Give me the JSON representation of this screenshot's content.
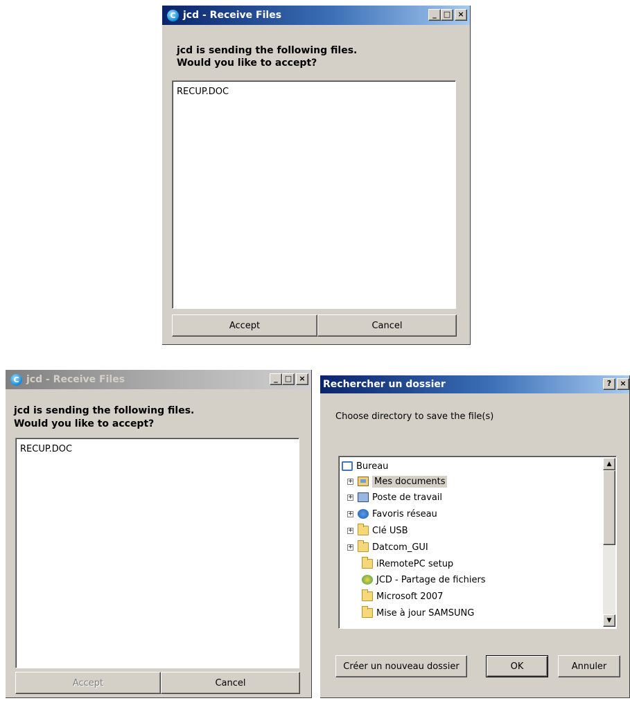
{
  "receive_dialog": {
    "title": "jcd - Receive Files",
    "app_icon": "C",
    "message_line1": "jcd is sending the following files.",
    "message_line2": "Would you like to accept?",
    "files": [
      "RECUP.DOC"
    ],
    "accept_label": "Accept",
    "cancel_label": "Cancel",
    "minimize_glyph": "_",
    "maximize_glyph": "□",
    "close_glyph": "×"
  },
  "receive_dialog_inactive": {
    "title": "jcd - Receive Files",
    "app_icon": "C",
    "message_line1": "jcd is sending the following files.",
    "message_line2": "Would you like to accept?",
    "files": [
      "RECUP.DOC"
    ],
    "accept_label": "Accept",
    "cancel_label": "Cancel",
    "minimize_glyph": "_",
    "maximize_glyph": "□",
    "close_glyph": "×"
  },
  "browse_dialog": {
    "title": "Rechercher un dossier",
    "help_glyph": "?",
    "close_glyph": "×",
    "prompt": "Choose directory to save the file(s)",
    "tree": [
      {
        "label": "Bureau",
        "icon": "desktop-icon"
      },
      {
        "label": "Mes documents",
        "icon": "my-documents-icon",
        "expander": "+",
        "selected": true
      },
      {
        "label": "Poste de travail",
        "icon": "computer-icon",
        "expander": "+"
      },
      {
        "label": "Favoris réseau",
        "icon": "network-icon",
        "expander": "+"
      },
      {
        "label": "Clé USB",
        "icon": "folder-icon",
        "expander": "+"
      },
      {
        "label": "Datcom_GUI",
        "icon": "folder-icon",
        "expander": "+"
      },
      {
        "label": "iRemotePC setup",
        "icon": "folder-icon"
      },
      {
        "label": "JCD - Partage de fichiers",
        "icon": "app-icon"
      },
      {
        "label": "Microsoft 2007",
        "icon": "folder-icon"
      },
      {
        "label": "Mise à jour SAMSUNG",
        "icon": "folder-icon"
      }
    ],
    "scroll_up_glyph": "▲",
    "scroll_down_glyph": "▼",
    "new_folder_label": "Créer un nouveau dossier",
    "ok_label": "OK",
    "cancel_label": "Annuler"
  }
}
